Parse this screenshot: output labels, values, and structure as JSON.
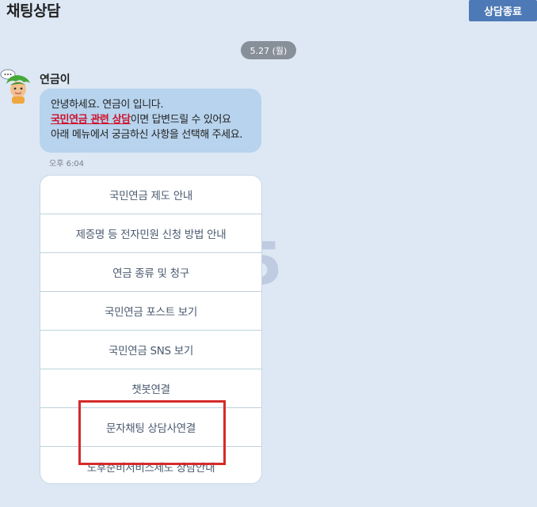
{
  "header": {
    "title": "채팅상담",
    "end_button": "상담종료"
  },
  "conversation": {
    "date_label": "5.27 (월)",
    "watermark_glyph": "5",
    "bot": {
      "name": "연금이",
      "greeting_line1": "안녕하세요. 연금이 입니다.",
      "greeting_highlight": "국민연금 관련 상담",
      "greeting_line2_rest": "이면 답변드릴 수 있어요",
      "greeting_line3": "아래 메뉴에서 궁금하신 사항을 선택해 주세요.",
      "time": "오후 6:04"
    },
    "menu": [
      "국민연금 제도 안내",
      "제증명 등 전자민원 신청 방법 안내",
      "연금 종류 및 청구",
      "국민연금 포스트 보기",
      "국민연금 SNS 보기",
      "챗봇연결",
      "문자채팅 상담사연결",
      "노후준비서비스제도 상담안내"
    ]
  },
  "colors": {
    "background": "#dde8f4",
    "bubble": "#b7d3ed",
    "end_button": "#4d7ab6",
    "highlight_text": "#d0102a",
    "annotation_box": "#d52a2a"
  }
}
